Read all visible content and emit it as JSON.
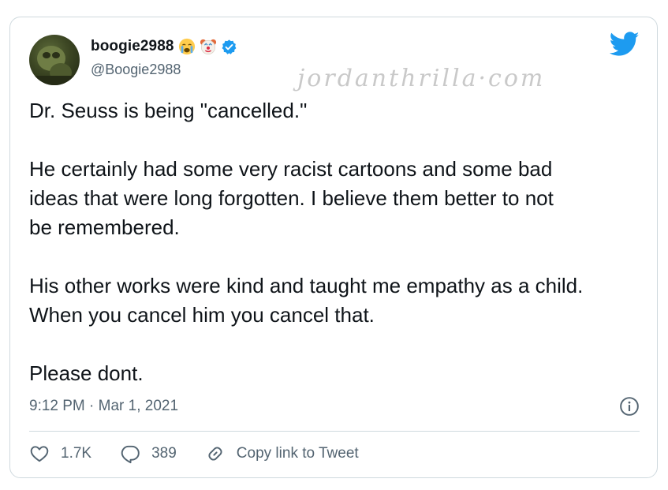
{
  "user": {
    "display_name": "boogie2988",
    "handle": "@Boogie2988",
    "emojis": [
      "crying-face-emoji",
      "clown-face-emoji"
    ],
    "verified": true
  },
  "watermark": "jordanthrilla·com",
  "tweet": {
    "paragraphs": [
      [
        "Dr. Seuss is being \"cancelled.\""
      ],
      [
        "He certainly had some very racist cartoons and some bad",
        "ideas that were long forgotten.  I believe them better to not",
        "be remembered."
      ],
      [
        "His other works were kind and taught me empathy as a child.",
        "When you cancel him you cancel that."
      ],
      [
        "Please dont."
      ]
    ],
    "timestamp": "9:12 PM · Mar 1, 2021"
  },
  "actions": {
    "likes": "1.7K",
    "replies": "389",
    "copy_link": "Copy link to Tweet"
  },
  "colors": {
    "twitter_blue": "#1d9bf0",
    "secondary_text": "#536471",
    "border": "#cfd9de"
  },
  "icons": [
    "twitter-bird-icon",
    "verified-badge-icon",
    "info-icon",
    "heart-icon",
    "reply-icon",
    "link-icon"
  ]
}
